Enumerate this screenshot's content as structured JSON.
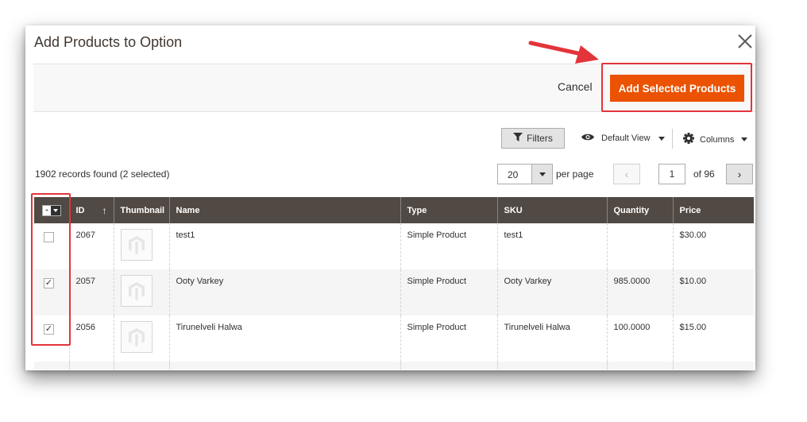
{
  "modal": {
    "title": "Add Products to Option"
  },
  "actions": {
    "cancel_label": "Cancel",
    "add_label": "Add Selected Products"
  },
  "toolbar": {
    "filters_label": "Filters",
    "view_label": "Default View",
    "columns_label": "Columns"
  },
  "summary": {
    "records_text": "1902 records found (2 selected)"
  },
  "pagination": {
    "per_page_value": "20",
    "per_page_label": "per page",
    "current_page": "1",
    "of_text": "of 96",
    "prev_label": "‹",
    "next_label": "›"
  },
  "grid": {
    "headers": {
      "id": "ID",
      "sort_indicator": "↑",
      "thumbnail": "Thumbnail",
      "name": "Name",
      "type": "Type",
      "sku": "SKU",
      "quantity": "Quantity",
      "price": "Price"
    },
    "rows": [
      {
        "checked": false,
        "check_mark": "",
        "id": "2067",
        "name": "test1",
        "type": "Simple Product",
        "sku": "test1",
        "quantity": "",
        "price": "$30.00"
      },
      {
        "checked": true,
        "check_mark": "✓",
        "id": "2057",
        "name": "Ooty Varkey",
        "type": "Simple Product",
        "sku": "Ooty Varkey",
        "quantity": "985.0000",
        "price": "$10.00"
      },
      {
        "checked": true,
        "check_mark": "✓",
        "id": "2056",
        "name": "Tirunelveli Halwa",
        "type": "Simple Product",
        "sku": "Tirunelveli Halwa",
        "quantity": "100.0000",
        "price": "$15.00"
      }
    ]
  },
  "colors": {
    "accent": "#eb5202",
    "header_bg": "#514943",
    "highlight": "#e3343a"
  },
  "icons": {
    "close": "close-icon",
    "filter": "funnel-icon",
    "view": "eye-icon",
    "columns": "gear-icon",
    "thumbnail": "magento-placeholder-icon"
  }
}
